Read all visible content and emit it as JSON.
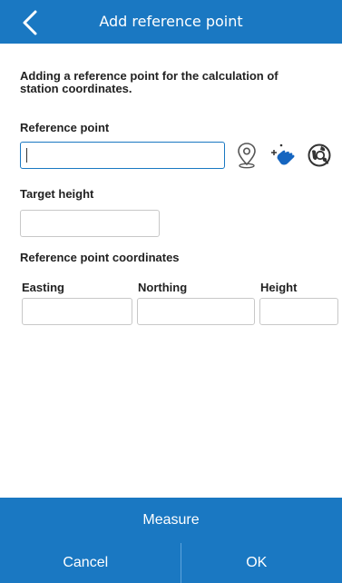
{
  "header": {
    "title": "Add reference point"
  },
  "intro": "Adding a reference point for the calculation of station coordinates.",
  "reference_point": {
    "label": "Reference point",
    "value": ""
  },
  "target_height": {
    "label": "Target height",
    "value": ""
  },
  "coordinates": {
    "label": "Reference point coordinates",
    "easting": {
      "label": "Easting",
      "value": ""
    },
    "northing": {
      "label": "Northing",
      "value": ""
    },
    "height": {
      "label": "Height",
      "value": ""
    }
  },
  "actions": {
    "measure": "Measure",
    "cancel": "Cancel",
    "ok": "OK"
  },
  "icons": [
    "chevron-left-icon",
    "map-pin-icon",
    "tap-select-icon",
    "globe-search-icon"
  ],
  "colors": {
    "accent": "#1a78c2",
    "icon_blue": "#1565c0"
  }
}
